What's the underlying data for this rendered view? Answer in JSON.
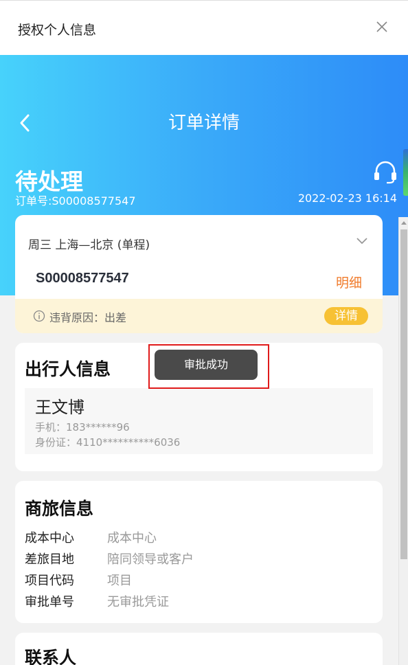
{
  "dialog": {
    "title": "授权个人信息"
  },
  "header": {
    "nav_title": "订单详情",
    "status": "待处理",
    "order_no": "订单号:S00008577547",
    "order_time": "2022-02-23 16:14"
  },
  "trip_card": {
    "route": "周三 上海—北京 (单程)",
    "order_no": "S00008577547",
    "detail_link": "明细",
    "violation_reason": "违背原因：出差",
    "detail_button": "详情"
  },
  "passenger_section": {
    "title": "出行人信息",
    "name": "王文博",
    "phone": "手机：183******96",
    "id_card": "身份证：4110**********6036"
  },
  "business_section": {
    "title": "商旅信息",
    "rows": [
      {
        "key": "成本中心",
        "value": "成本中心"
      },
      {
        "key": "差旅目地",
        "value": "陪同领导或客户"
      },
      {
        "key": "项目代码",
        "value": "项目"
      },
      {
        "key": "审批单号",
        "value": "无审批凭证"
      }
    ]
  },
  "contact_section": {
    "title": "联系人"
  },
  "toast": {
    "message": "审批成功"
  },
  "colors": {
    "gradient_start": "#47d2fb",
    "gradient_end": "#2d8cf8",
    "accent_orange": "#f07a2a",
    "badge_yellow": "#f7c134",
    "violation_bg": "#fdf4d8"
  }
}
